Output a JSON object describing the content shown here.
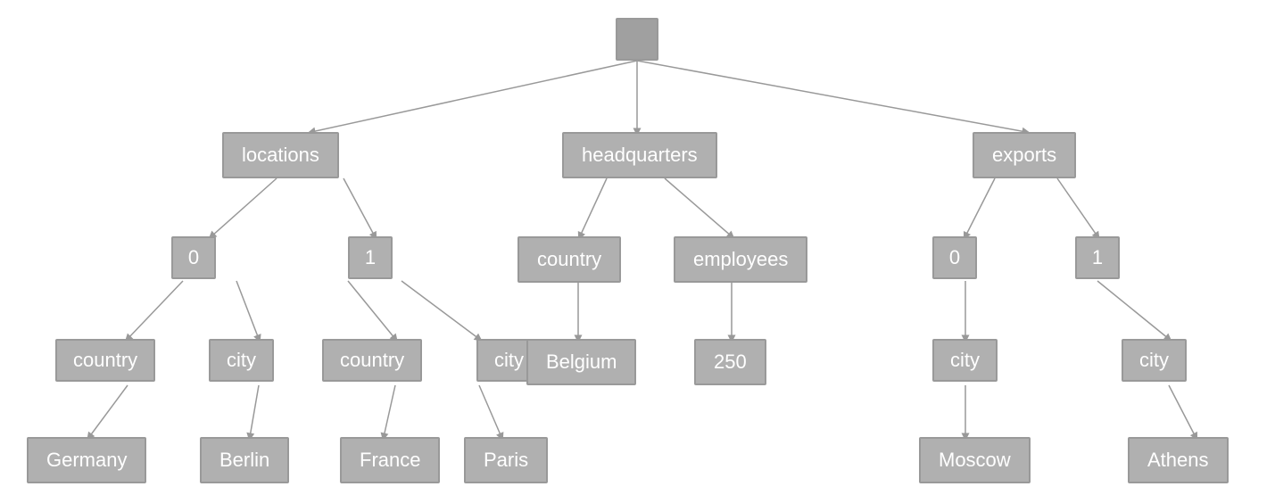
{
  "nodes": {
    "root": {
      "label": ""
    },
    "locations": {
      "label": "locations"
    },
    "headquarters": {
      "label": "headquarters"
    },
    "exports": {
      "label": "exports"
    },
    "loc_0": {
      "label": "0"
    },
    "loc_1": {
      "label": "1"
    },
    "hq_country": {
      "label": "country"
    },
    "hq_employees": {
      "label": "employees"
    },
    "exp_0": {
      "label": "0"
    },
    "exp_1": {
      "label": "1"
    },
    "loc0_country": {
      "label": "country"
    },
    "loc0_city": {
      "label": "city"
    },
    "loc1_country": {
      "label": "country"
    },
    "loc1_city": {
      "label": "city"
    },
    "hq_belgium": {
      "label": "Belgium"
    },
    "hq_250": {
      "label": "250"
    },
    "exp0_city": {
      "label": "city"
    },
    "exp1_city": {
      "label": "city"
    },
    "germany": {
      "label": "Germany"
    },
    "berlin": {
      "label": "Berlin"
    },
    "france": {
      "label": "France"
    },
    "paris": {
      "label": "Paris"
    },
    "moscow": {
      "label": "Moscow"
    },
    "athens": {
      "label": "Athens"
    }
  }
}
